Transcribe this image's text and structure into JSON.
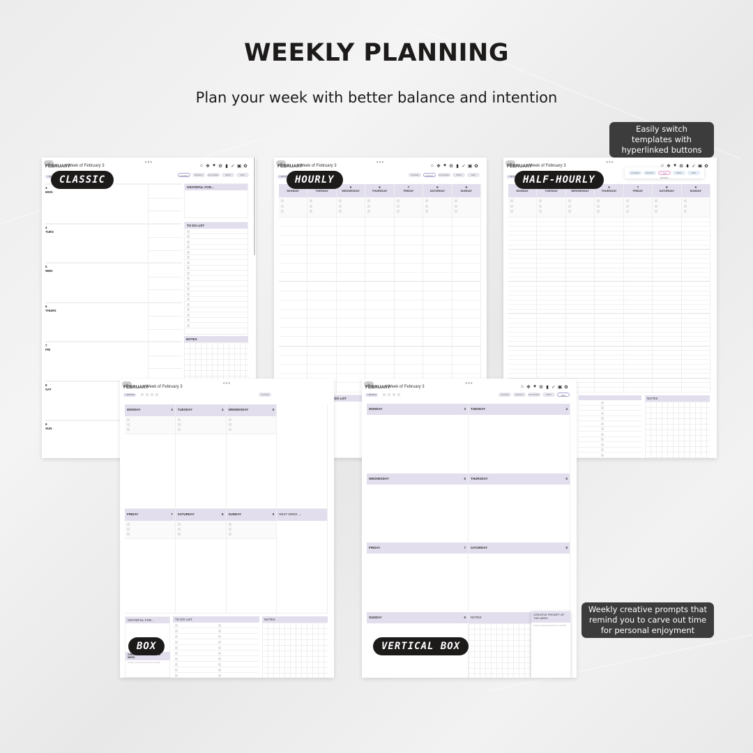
{
  "header": {
    "title": "WEEKLY PLANNING",
    "subtitle": "Plan your week with better balance and intention"
  },
  "callouts": {
    "templates": "Easily switch templates with hyperlinked buttons",
    "prompts": "Weekly creative prompts that remind you to carve out time for personal enjoyment"
  },
  "planner": {
    "month": "FEBRUARY",
    "week": "Week of February 3",
    "nav_prev": "< MONTH",
    "toolbar_icons": [
      "home-icon",
      "move-icon",
      "heart-icon",
      "gear-icon",
      "chart-icon",
      "check-icon",
      "note-icon",
      "settings-icon"
    ],
    "template_buttons": [
      "CLASSIC",
      "HOURLY",
      "1/2 HOURLY",
      "VBOX",
      "BOX"
    ],
    "days_full": [
      "MONDAY",
      "TUESDAY",
      "WEDNESDAY",
      "THURSDAY",
      "FRIDAY",
      "SATURDAY",
      "SUNDAY"
    ],
    "days_short": [
      "MON",
      "TUES",
      "WED",
      "THURS",
      "FRI",
      "SAT",
      "SUN"
    ],
    "dates": [
      "3",
      "4",
      "5",
      "6",
      "7",
      "8",
      "9"
    ],
    "grateful": "GRATEFUL FOR...",
    "todo": "TO DO LIST",
    "notes": "NOTES",
    "next_week": "NEXT WEEK →",
    "creative_prompt_title": "CREATIVE PROMPT OF THE WEEK",
    "creative_prompt_text": "Create a greeting card from scratch"
  },
  "labels": {
    "classic": "CLASSIC",
    "hourly": "HOURLY",
    "half_hourly": "HALF-HOURLY",
    "box": "BOX",
    "vertical_box": "VERTICAL BOX"
  }
}
